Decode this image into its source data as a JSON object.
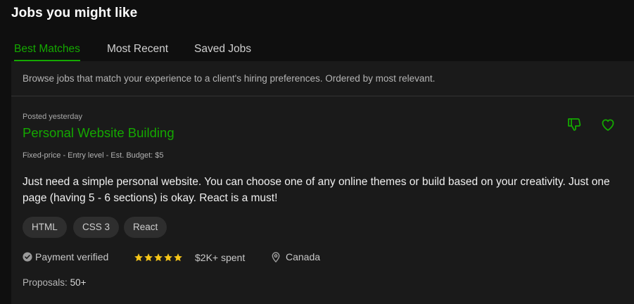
{
  "header": {
    "title": "Jobs you might like"
  },
  "tabs": [
    {
      "label": "Best Matches",
      "active": true
    },
    {
      "label": "Most Recent",
      "active": false
    },
    {
      "label": "Saved Jobs",
      "active": false
    }
  ],
  "browse_text": "Browse jobs that match your experience to a client's hiring preferences. Ordered by most relevant.",
  "job": {
    "posted": "Posted yesterday",
    "title": "Personal Website Building",
    "meta": "Fixed-price - Entry level - Est. Budget: $5",
    "description": "Just need a simple personal website. You can choose one of any online themes or build based on your creativity. Just one page (having 5 - 6 sections) is okay. React is a must!",
    "skills": [
      "HTML",
      "CSS 3",
      "React"
    ],
    "payment_status": "Payment verified",
    "rating_stars": 5,
    "spent": "$2K+ spent",
    "location": "Canada",
    "proposals_label": "Proposals:",
    "proposals_count": "50+"
  },
  "icons": {
    "dislike": "thumbs-down-icon",
    "save": "heart-icon",
    "verified": "check-badge-icon",
    "star": "star-icon",
    "location": "map-pin-icon"
  },
  "colors": {
    "accent": "#14a800",
    "star": "#f5c518",
    "background": "#0f0f0f",
    "card": "#1a1a1a"
  }
}
